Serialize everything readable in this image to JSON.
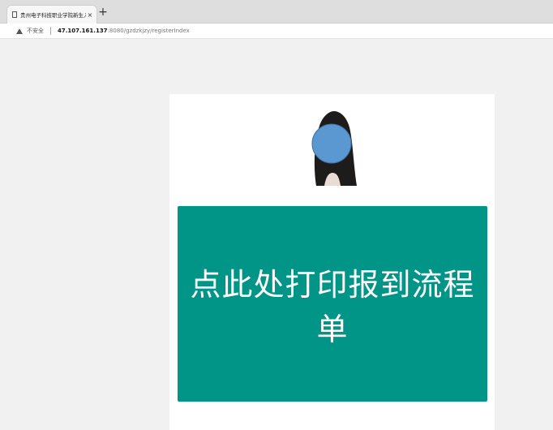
{
  "browser": {
    "tab_title": "贵州电子科技职业学院新生入学",
    "tab_close": "×",
    "new_tab": "+",
    "security_label": "不安全",
    "url_host": "47.107.161.137",
    "url_path": ":8080/gzdzkjzy/registerIndex"
  },
  "page": {
    "photo_icon": "student-photo",
    "print_button_label": "点此处打印报到流程单",
    "accent_color": "#009587"
  }
}
